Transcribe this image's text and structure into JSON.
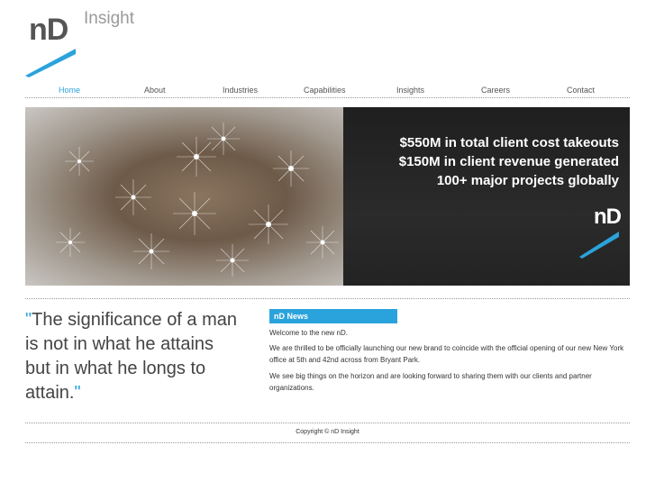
{
  "brand": {
    "mark": "nD",
    "product": "Insight"
  },
  "nav": {
    "items": [
      {
        "label": "Home",
        "active": true
      },
      {
        "label": "About"
      },
      {
        "label": "Industries"
      },
      {
        "label": "Capabilities"
      },
      {
        "label": "Insights"
      },
      {
        "label": "Careers"
      },
      {
        "label": "Contact"
      }
    ]
  },
  "hero": {
    "stats": [
      "$550M in total client cost takeouts",
      "$150M in client revenue generated",
      "100+ major projects globally"
    ],
    "mark": "nD"
  },
  "quote": {
    "open": "\"",
    "text": "The significance of a man is not in what he attains but in what he longs to attain.",
    "close": "\""
  },
  "news": {
    "heading": "nD News",
    "paragraphs": [
      "Welcome to the new nD.",
      "We are thrilled to be officially launching our new brand to coincide with the official opening of our new New York office at 5th and 42nd across from Bryant Park.",
      "We see big things on the horizon and are looking forward to sharing them with our clients and partner organizations."
    ]
  },
  "footer": {
    "copyright": "Copyright © nD Insight"
  },
  "colors": {
    "accent": "#2aa3dc",
    "text": "#444444",
    "panel": "#262626"
  }
}
